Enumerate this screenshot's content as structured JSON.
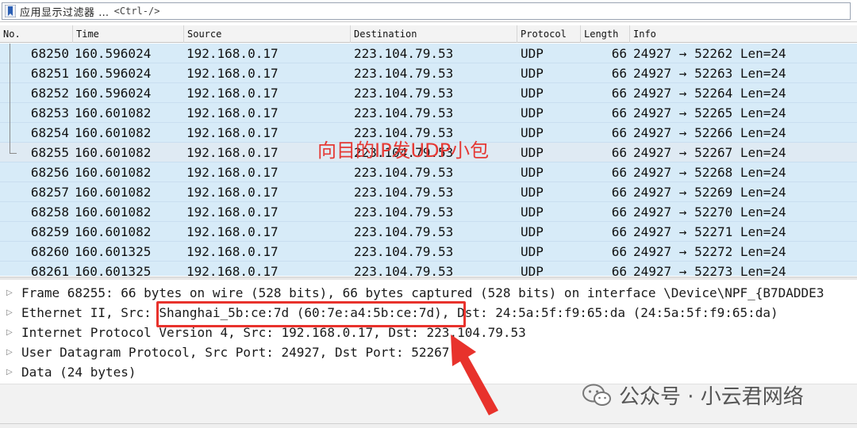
{
  "filter": {
    "placeholder": "应用显示过滤器 …",
    "shortcut": "<Ctrl-/>"
  },
  "columns": [
    "No.",
    "Time",
    "Source",
    "Destination",
    "Protocol",
    "Length",
    "Info"
  ],
  "packets": [
    {
      "no": "68250",
      "time": "160.596024",
      "src": "192.168.0.17",
      "dst": "223.104.79.53",
      "proto": "UDP",
      "len": "66",
      "info": "24927 → 52262 Len=24"
    },
    {
      "no": "68251",
      "time": "160.596024",
      "src": "192.168.0.17",
      "dst": "223.104.79.53",
      "proto": "UDP",
      "len": "66",
      "info": "24927 → 52263 Len=24"
    },
    {
      "no": "68252",
      "time": "160.596024",
      "src": "192.168.0.17",
      "dst": "223.104.79.53",
      "proto": "UDP",
      "len": "66",
      "info": "24927 → 52264 Len=24"
    },
    {
      "no": "68253",
      "time": "160.601082",
      "src": "192.168.0.17",
      "dst": "223.104.79.53",
      "proto": "UDP",
      "len": "66",
      "info": "24927 → 52265 Len=24"
    },
    {
      "no": "68254",
      "time": "160.601082",
      "src": "192.168.0.17",
      "dst": "223.104.79.53",
      "proto": "UDP",
      "len": "66",
      "info": "24927 → 52266 Len=24"
    },
    {
      "no": "68255",
      "time": "160.601082",
      "src": "192.168.0.17",
      "dst": "223.104.79.53",
      "proto": "UDP",
      "len": "66",
      "info": "24927 → 52267 Len=24"
    },
    {
      "no": "68256",
      "time": "160.601082",
      "src": "192.168.0.17",
      "dst": "223.104.79.53",
      "proto": "UDP",
      "len": "66",
      "info": "24927 → 52268 Len=24"
    },
    {
      "no": "68257",
      "time": "160.601082",
      "src": "192.168.0.17",
      "dst": "223.104.79.53",
      "proto": "UDP",
      "len": "66",
      "info": "24927 → 52269 Len=24"
    },
    {
      "no": "68258",
      "time": "160.601082",
      "src": "192.168.0.17",
      "dst": "223.104.79.53",
      "proto": "UDP",
      "len": "66",
      "info": "24927 → 52270 Len=24"
    },
    {
      "no": "68259",
      "time": "160.601082",
      "src": "192.168.0.17",
      "dst": "223.104.79.53",
      "proto": "UDP",
      "len": "66",
      "info": "24927 → 52271 Len=24"
    },
    {
      "no": "68260",
      "time": "160.601325",
      "src": "192.168.0.17",
      "dst": "223.104.79.53",
      "proto": "UDP",
      "len": "66",
      "info": "24927 → 52272 Len=24"
    },
    {
      "no": "68261",
      "time": "160.601325",
      "src": "192.168.0.17",
      "dst": "223.104.79.53",
      "proto": "UDP",
      "len": "66",
      "info": "24927 → 52273 Len=24"
    }
  ],
  "selected_packet": "68255",
  "details": [
    "Frame 68255: 66 bytes on wire (528 bits), 66 bytes captured (528 bits) on interface \\Device\\NPF_{B7DADDE3",
    "Ethernet II, Src: Shanghai_5b:ce:7d (60:7e:a4:5b:ce:7d), Dst: 24:5a:5f:f9:65:da (24:5a:5f:f9:65:da)",
    "Internet Protocol Version 4, Src: 192.168.0.17, Dst: 223.104.79.53",
    "User Datagram Protocol, Src Port: 24927, Dst Port: 52267",
    "Data (24 bytes)"
  ],
  "annotation": "向目的IP发UDP小包",
  "watermark": "公众号 · 小云君网络",
  "colors": {
    "row_bg": "#d7ebf8",
    "selected_row_bg": "#dfeaf3",
    "annotation": "#e53935"
  },
  "icons": [
    "bookmark-icon",
    "wechat-icon",
    "expand-arrow-icon"
  ]
}
